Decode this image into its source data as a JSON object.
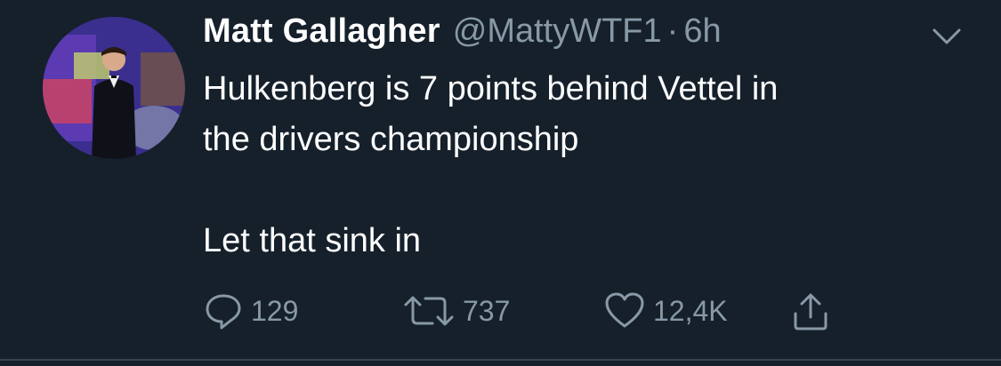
{
  "tweet": {
    "display_name": "Matt Gallagher",
    "handle": "@MattyWTF1",
    "separator": "·",
    "time": "6h",
    "text": "Hulkenberg is 7 points behind Vettel in\nthe drivers championship\n\nLet that sink in",
    "avatar_icon": "profile-photo"
  },
  "actions": {
    "reply": {
      "icon": "reply-icon",
      "count": "129"
    },
    "retweet": {
      "icon": "retweet-icon",
      "count": "737"
    },
    "like": {
      "icon": "heart-icon",
      "count": "12,4K"
    },
    "share": {
      "icon": "share-icon"
    }
  },
  "colors": {
    "background": "#15202b",
    "text": "#ffffff",
    "secondary": "#8899a6",
    "divider": "#38444d"
  }
}
